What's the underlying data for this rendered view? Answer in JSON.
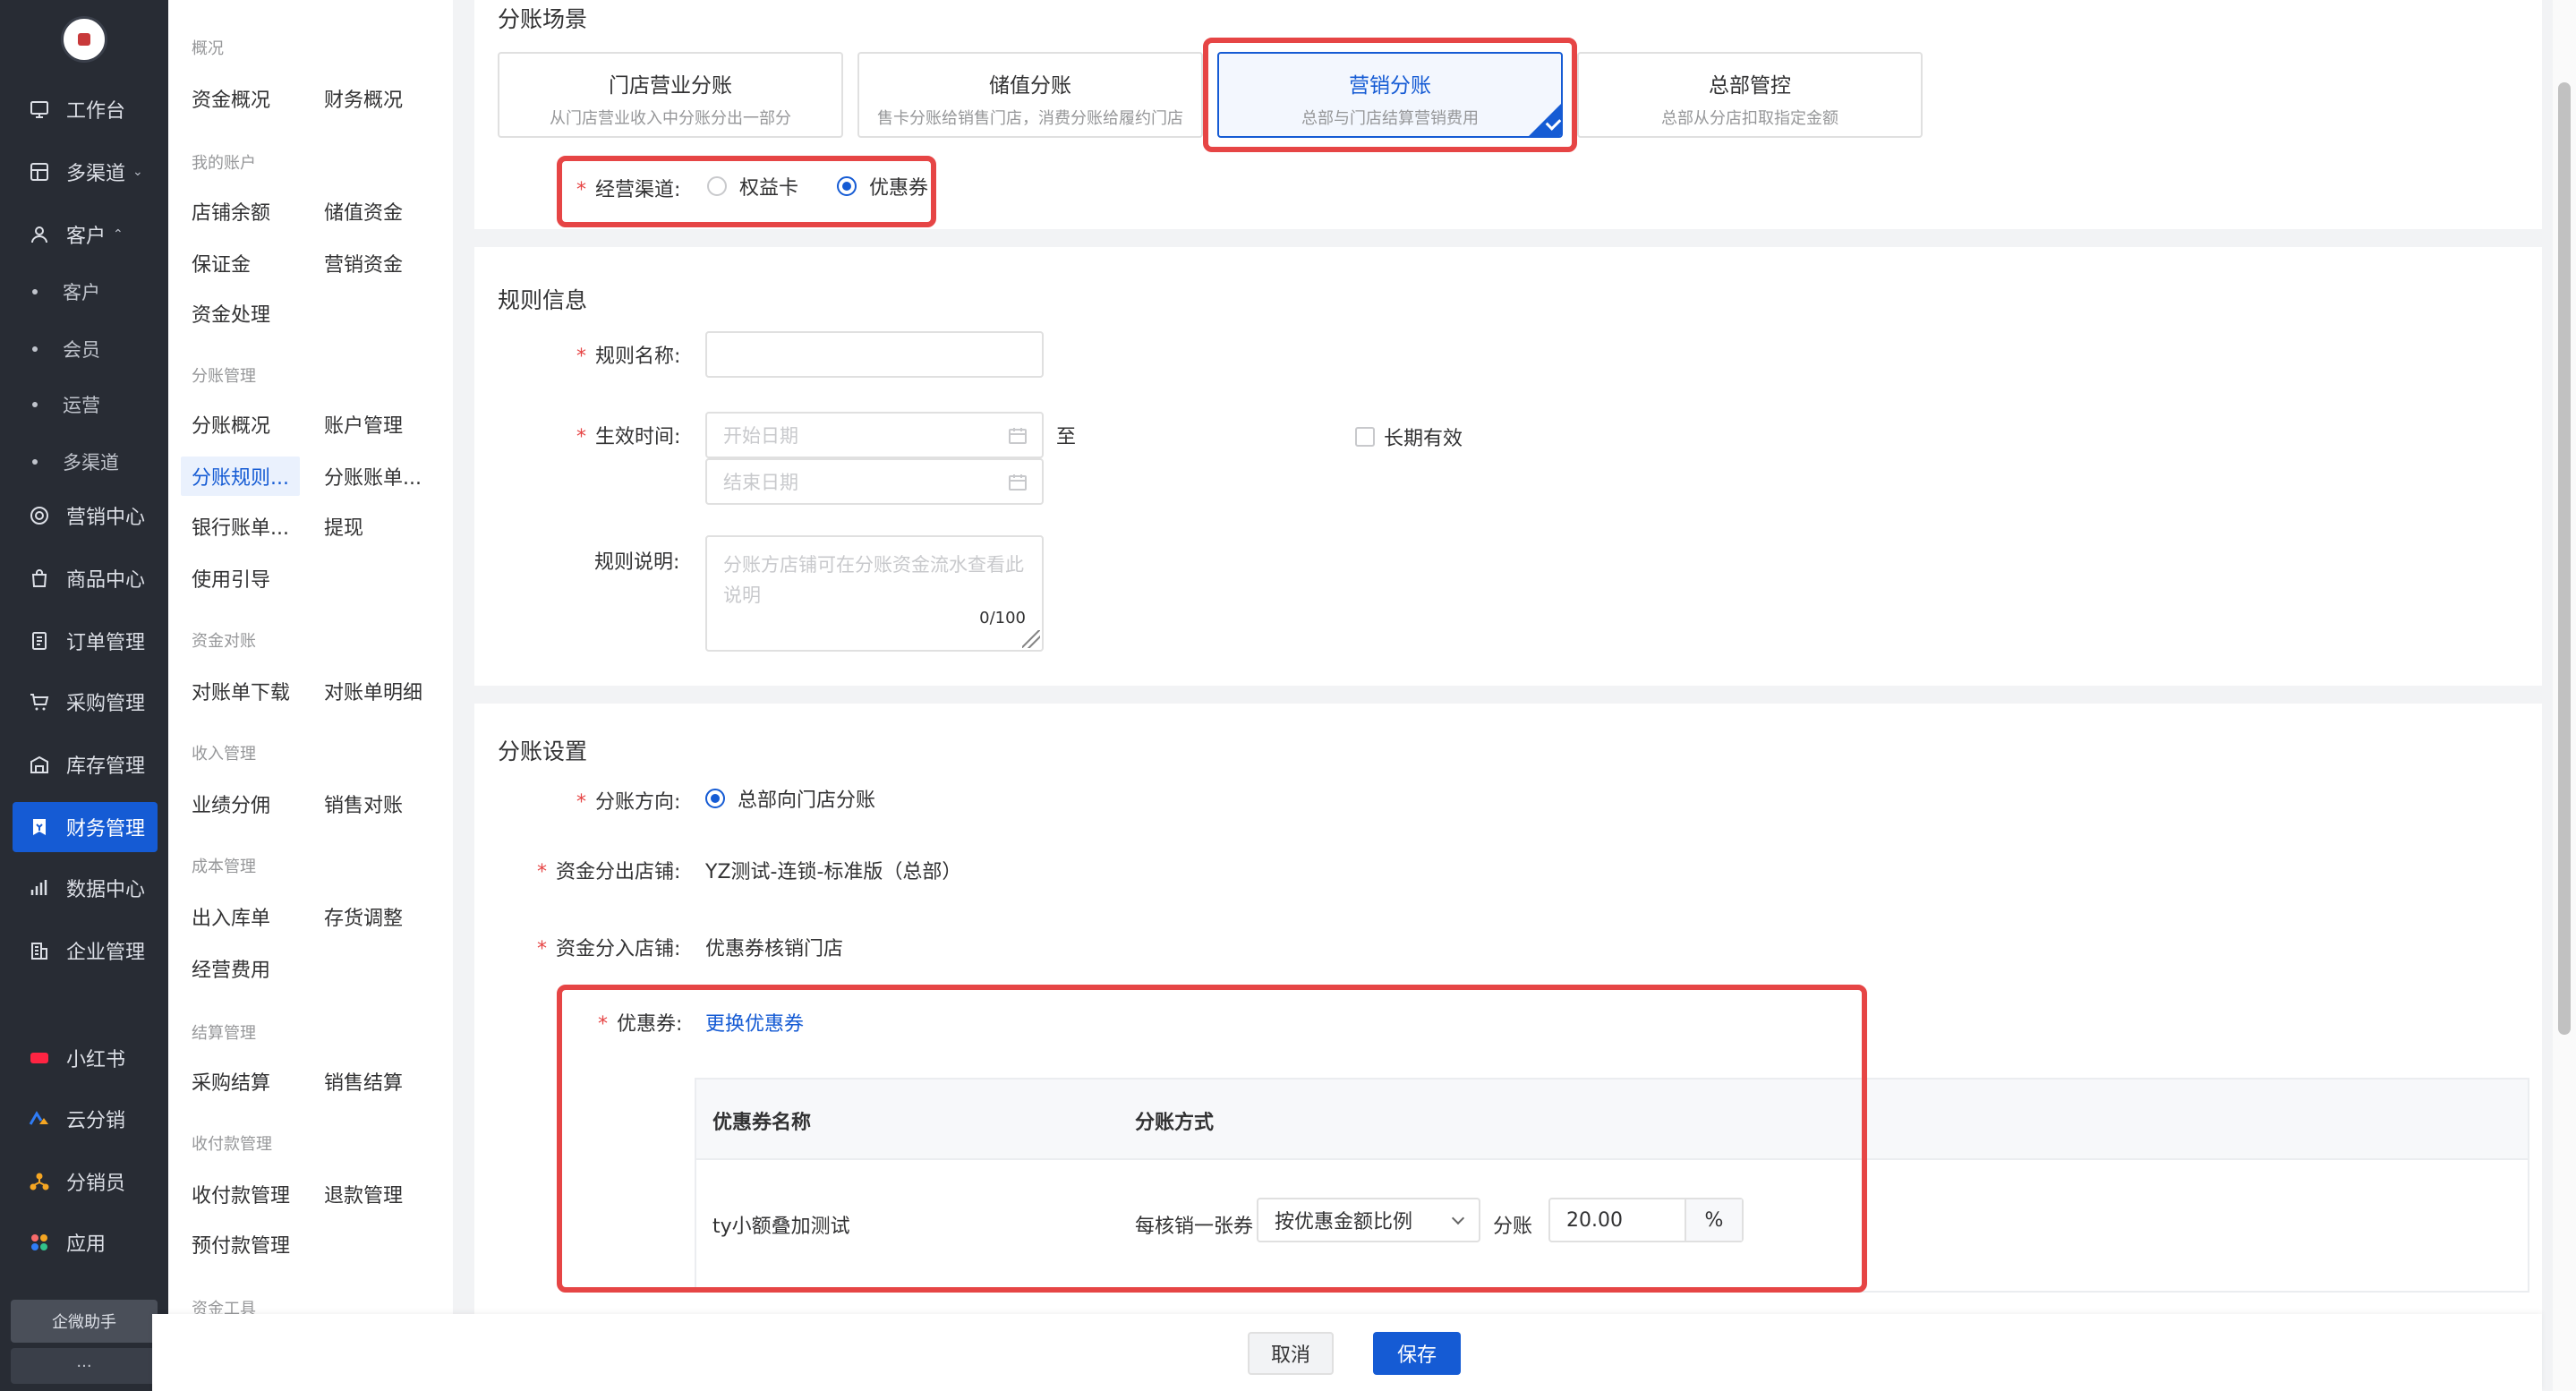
{
  "nav": {
    "items": [
      {
        "label": "工作台",
        "icon": "workbench-icon"
      },
      {
        "label": "多渠道",
        "icon": "multichannel-icon",
        "arrow": "⌄"
      },
      {
        "label": "客户",
        "icon": "user-icon",
        "arrow": "⌃"
      },
      {
        "label": "营销中心",
        "icon": "target-icon"
      },
      {
        "label": "商品中心",
        "icon": "bag-icon"
      },
      {
        "label": "订单管理",
        "icon": "order-icon"
      },
      {
        "label": "采购管理",
        "icon": "cart-icon"
      },
      {
        "label": "库存管理",
        "icon": "warehouse-icon"
      },
      {
        "label": "财务管理",
        "icon": "finance-icon"
      },
      {
        "label": "数据中心",
        "icon": "chart-icon"
      },
      {
        "label": "企业管理",
        "icon": "enterprise-icon"
      },
      {
        "label": "小红书",
        "icon": "xiaohongshu-icon"
      },
      {
        "label": "云分销",
        "icon": "cloud-distribution-icon"
      },
      {
        "label": "分销员",
        "icon": "distributor-icon"
      },
      {
        "label": "应用",
        "icon": "apps-icon"
      }
    ],
    "customer_sub": [
      "客户",
      "会员",
      "运营",
      "多渠道"
    ],
    "assistant": "企微助手",
    "more": "···"
  },
  "subnav": {
    "groups": [
      "概况",
      "我的账户",
      "分账管理",
      "资金对账",
      "收入管理",
      "成本管理",
      "结算管理",
      "收付款管理",
      "资金工具"
    ],
    "links": [
      "资金概况",
      "财务概况",
      "店铺余额",
      "储值资金",
      "保证金",
      "营销资金",
      "资金处理",
      "分账概况",
      "账户管理",
      "分账规则...",
      "分账账单...",
      "银行账单...",
      "提现",
      "使用引导",
      "对账单下载",
      "对账单明细",
      "业绩分佣",
      "销售对账",
      "出入库单",
      "存货调整",
      "经营费用",
      "采购结算",
      "销售结算",
      "收付款管理",
      "退款管理",
      "预付款管理"
    ]
  },
  "scene": {
    "title": "分账场景",
    "options": [
      {
        "title": "门店营业分账",
        "desc": "从门店营业收入中分账分出一部分"
      },
      {
        "title": "储值分账",
        "desc": "售卡分账给销售门店，消费分账给履约门店"
      },
      {
        "title": "营销分账",
        "desc": "总部与门店结算营销费用"
      },
      {
        "title": "总部管控",
        "desc": "总部从分店扣取指定金额"
      }
    ],
    "channel_label": "经营渠道:",
    "channel_options": [
      "权益卡",
      "优惠券"
    ]
  },
  "rule": {
    "title": "规则信息",
    "name_label": "规则名称:",
    "time_label": "生效时间:",
    "start_placeholder": "开始日期",
    "to": "至",
    "end_placeholder": "结束日期",
    "long_term": "长期有效",
    "desc_label": "规则说明:",
    "desc_placeholder": "分账方店铺可在分账资金流水查看此说明",
    "desc_count": "0/100"
  },
  "settings": {
    "title": "分账设置",
    "direction_label": "分账方向:",
    "direction_value": "总部向门店分账",
    "out_label": "资金分出店铺:",
    "out_value": "YZ测试-连锁-标准版（总部）",
    "in_label": "资金分入店铺:",
    "in_value": "优惠券核销门店",
    "coupon_label": "优惠券:",
    "change_coupon": "更换优惠券",
    "table": {
      "headers": [
        "优惠券名称",
        "分账方式"
      ],
      "row": {
        "name": "ty小额叠加测试",
        "per": "每核销一张券",
        "method": "按优惠金额比例",
        "split": "分账",
        "value": "20.00",
        "unit": "%"
      }
    }
  },
  "actions": {
    "cancel": "取消",
    "save": "保存"
  },
  "colors": {
    "primary": "#155bd4",
    "highlight": "#e64545",
    "nav_bg": "#282c34"
  }
}
